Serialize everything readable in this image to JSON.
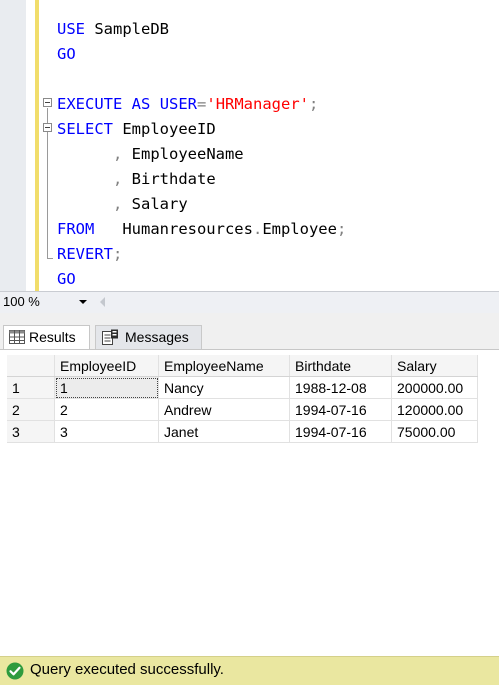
{
  "editor": {
    "lines": [
      {
        "parts": [
          {
            "t": "USE",
            "c": "kw"
          },
          {
            "t": " SampleDB",
            "c": ""
          }
        ]
      },
      {
        "parts": [
          {
            "t": "GO",
            "c": "kw"
          }
        ]
      },
      {
        "parts": []
      },
      {
        "parts": [
          {
            "t": "EXECUTE",
            "c": "kw"
          },
          {
            "t": " ",
            "c": ""
          },
          {
            "t": "AS",
            "c": "kw"
          },
          {
            "t": " ",
            "c": ""
          },
          {
            "t": "USER",
            "c": "kw"
          },
          {
            "t": "=",
            "c": "gray"
          },
          {
            "t": "'HRManager'",
            "c": "str"
          },
          {
            "t": ";",
            "c": "gray"
          }
        ]
      },
      {
        "parts": [
          {
            "t": "SELECT",
            "c": "kw"
          },
          {
            "t": " EmployeeID",
            "c": ""
          }
        ]
      },
      {
        "parts": [
          {
            "t": "      ,",
            "c": "gray"
          },
          {
            "t": " EmployeeName",
            "c": ""
          }
        ]
      },
      {
        "parts": [
          {
            "t": "      ,",
            "c": "gray"
          },
          {
            "t": " Birthdate",
            "c": ""
          }
        ]
      },
      {
        "parts": [
          {
            "t": "      ,",
            "c": "gray"
          },
          {
            "t": " Salary",
            "c": ""
          }
        ]
      },
      {
        "parts": [
          {
            "t": "FROM",
            "c": "kw"
          },
          {
            "t": "   Humanresources",
            "c": ""
          },
          {
            "t": ".",
            "c": "gray"
          },
          {
            "t": "Employee",
            "c": ""
          },
          {
            "t": ";",
            "c": "gray"
          }
        ]
      },
      {
        "parts": [
          {
            "t": "REVERT",
            "c": "kw"
          },
          {
            "t": ";",
            "c": "gray"
          }
        ]
      },
      {
        "parts": [
          {
            "t": "GO",
            "c": "kw"
          }
        ]
      }
    ]
  },
  "zoom": {
    "value": "100 %"
  },
  "tabs": {
    "results_label": "Results",
    "messages_label": "Messages"
  },
  "results": {
    "columns": [
      "EmployeeID",
      "EmployeeName",
      "Birthdate",
      "Salary"
    ],
    "rows": [
      {
        "num": "1",
        "cells": [
          "1",
          "Nancy",
          "1988-12-08",
          "200000.00"
        ]
      },
      {
        "num": "2",
        "cells": [
          "2",
          "Andrew",
          "1994-07-16",
          "120000.00"
        ]
      },
      {
        "num": "3",
        "cells": [
          "3",
          "Janet",
          "1994-07-16",
          "75000.00"
        ]
      }
    ]
  },
  "status": {
    "text": "Query executed successfully.",
    "color": "#eae7a0"
  },
  "icons": {
    "results": "grid-icon",
    "messages": "messages-icon",
    "status": "success-check-icon"
  },
  "colors": {
    "keyword": "#0000ff",
    "string": "#ff0000",
    "operator": "#808080",
    "change_bar": "#f1dd6b"
  }
}
